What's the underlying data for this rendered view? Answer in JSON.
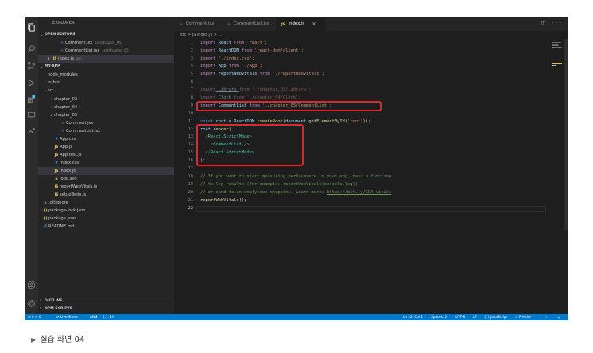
{
  "sidebar": {
    "title": "EXPLORER",
    "more": "···",
    "sections": {
      "open_editors": "OPEN EDITORS",
      "project": "MY-APP",
      "outline": "OUTLINE",
      "npm": "NPM SCRIPTS"
    },
    "open_editors": [
      {
        "icon": "JSX",
        "name": "Comment.jsx",
        "hint": "src/chapter_05"
      },
      {
        "icon": "JSX",
        "name": "CommentList.jsx",
        "hint": "src/chapter_05"
      },
      {
        "icon": "JS",
        "name": "index.js",
        "hint": "src",
        "close": "×"
      }
    ],
    "tree": [
      {
        "chev": "›",
        "icon": "",
        "name": "node_modules"
      },
      {
        "chev": "›",
        "icon": "",
        "name": "public"
      },
      {
        "chev": "⌄",
        "icon": "",
        "name": "src"
      },
      {
        "chev": "›",
        "icon": "",
        "name": "chapter_03"
      },
      {
        "chev": "›",
        "icon": "",
        "name": "chapter_04"
      },
      {
        "chev": "⌄",
        "icon": "",
        "name": "chapter_05"
      },
      {
        "chev": "",
        "icon": "JSX",
        "name": "Comment.jsx"
      },
      {
        "chev": "",
        "icon": "JSX",
        "name": "CommentList.jsx"
      },
      {
        "chev": "",
        "icon": "#",
        "name": "App.css"
      },
      {
        "chev": "",
        "icon": "JS",
        "name": "App.js"
      },
      {
        "chev": "",
        "icon": "JS",
        "name": "App.test.js"
      },
      {
        "chev": "",
        "icon": "#",
        "name": "index.css"
      },
      {
        "chev": "",
        "icon": "JS",
        "name": "index.js"
      },
      {
        "chev": "",
        "icon": "◉",
        "name": "logo.svg"
      },
      {
        "chev": "",
        "icon": "JS",
        "name": "reportWebVitals.js"
      },
      {
        "chev": "",
        "icon": "JS",
        "name": "setupTests.js"
      },
      {
        "chev": "",
        "icon": "◆",
        "name": ".gitignore"
      },
      {
        "chev": "",
        "icon": "{}",
        "name": "package-lock.json"
      },
      {
        "chev": "",
        "icon": "{}",
        "name": "package.json"
      },
      {
        "chev": "",
        "icon": "ⓘ",
        "name": "README.md"
      }
    ]
  },
  "tabs": [
    {
      "icon": "⚛",
      "name": "Comment.jsx"
    },
    {
      "icon": "⚛",
      "name": "CommentList.jsx"
    },
    {
      "icon": "JS",
      "name": "index.js",
      "close": "×"
    }
  ],
  "tab_actions": "◫ ···",
  "breadcrumb": "src > JS index.js > ...",
  "code_lines": [
    "1",
    "2",
    "3",
    "4",
    "5",
    "6",
    "7",
    "8",
    "9",
    "10",
    "11",
    "12",
    "13",
    "14",
    "15",
    "16",
    "17",
    "18",
    "19",
    "20",
    "21",
    "22"
  ],
  "code": {
    "l1": [
      "import",
      " React ",
      "from",
      " 'react';"
    ],
    "l2": [
      "import",
      " ReactDOM ",
      "from",
      " 'react-dom/client';"
    ],
    "l3": [
      "import",
      " './index.css';"
    ],
    "l4": [
      "import",
      " App ",
      "from",
      " './App';"
    ],
    "l5": [
      "import",
      " reportWebVitals ",
      "from",
      " './reportWebVitals';"
    ],
    "l7": [
      "import",
      " Library ",
      "from",
      " './chapter_03/Library';"
    ],
    "l8": [
      "import",
      " Clock ",
      "from",
      " './chapter_04/Clock';"
    ],
    "l9": [
      "import",
      " CommentList ",
      "from",
      " './chapter_05/CommentList';"
    ],
    "l11": [
      "const",
      " root ",
      "= ",
      "ReactDOM",
      ".",
      "createRoot",
      "(",
      "document",
      ".",
      "getElementById",
      "(",
      "'root'",
      "));"
    ],
    "l12": [
      "root",
      ".",
      "render",
      "("
    ],
    "l13": [
      "  <",
      "React.StrictMode",
      ">"
    ],
    "l14": [
      "    <",
      "CommentList",
      " />"
    ],
    "l15": [
      "  </",
      "React.StrictMode",
      ">"
    ],
    "l16": [
      ");"
    ],
    "l18": "// If you want to start measuring performance in your app, pass a function",
    "l19": "// to log results (for example: reportWebVitals(console.log))",
    "l20": [
      "// or send to an analytics endpoint. Learn more: ",
      "https://bit.ly/CRA-vitals"
    ],
    "l21": [
      "reportWebVitals",
      "();"
    ]
  },
  "status": {
    "left": [
      "⊗ 0 ⚠ 0",
      "Live Share",
      "AWS",
      "{.}: 14"
    ],
    "right": [
      "Ln 22, Col 1",
      "Spaces: 2",
      "UTF-8",
      "LF",
      "{ } JavaScript",
      "✓ Prettier"
    ]
  },
  "caption": "실습 화면 04",
  "caption_marker": "▶",
  "colors": {
    "highlight": "#e0282c",
    "status_bar": "#007acc"
  }
}
